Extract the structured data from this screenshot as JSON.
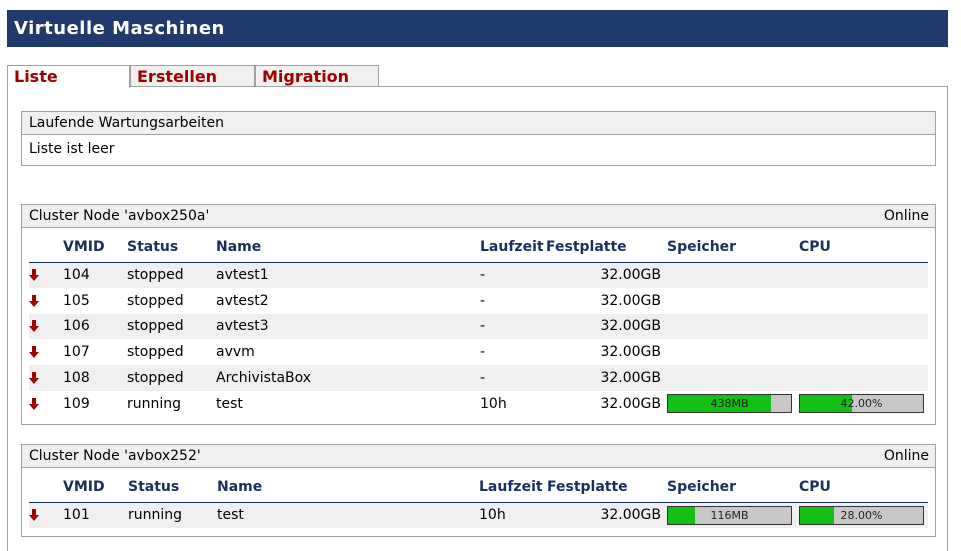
{
  "title": "Virtuelle Maschinen",
  "tabs": [
    {
      "label": "Liste",
      "active": true
    },
    {
      "label": "Erstellen",
      "active": false
    },
    {
      "label": "Migration",
      "active": false
    }
  ],
  "maintenance": {
    "header": "Laufende Wartungsarbeiten",
    "message": "Liste ist leer"
  },
  "columns": {
    "vmid": "VMID",
    "status": "Status",
    "name": "Name",
    "uptime": "Laufzeit",
    "disk": "Festplatte",
    "memory": "Speicher",
    "cpu": "CPU"
  },
  "nodes": [
    {
      "header": "Cluster Node 'avbox250a'",
      "state": "Online",
      "vms": [
        {
          "vmid": "104",
          "status": "stopped",
          "name": "avtest1",
          "uptime": "-",
          "disk": "32.00GB"
        },
        {
          "vmid": "105",
          "status": "stopped",
          "name": "avtest2",
          "uptime": "-",
          "disk": "32.00GB"
        },
        {
          "vmid": "106",
          "status": "stopped",
          "name": "avtest3",
          "uptime": "-",
          "disk": "32.00GB"
        },
        {
          "vmid": "107",
          "status": "stopped",
          "name": "avvm",
          "uptime": "-",
          "disk": "32.00GB"
        },
        {
          "vmid": "108",
          "status": "stopped",
          "name": "ArchivistaBox",
          "uptime": "-",
          "disk": "32.00GB"
        },
        {
          "vmid": "109",
          "status": "running",
          "name": "test",
          "uptime": "10h",
          "disk": "32.00GB",
          "memory": {
            "label": "438MB",
            "fraction": 0.84
          },
          "cpu": {
            "label": "42.00%",
            "fraction": 0.42
          }
        }
      ]
    },
    {
      "header": "Cluster Node 'avbox252'",
      "state": "Online",
      "vms": [
        {
          "vmid": "101",
          "status": "running",
          "name": "test",
          "uptime": "10h",
          "disk": "32.00GB",
          "memory": {
            "label": "116MB",
            "fraction": 0.22
          },
          "cpu": {
            "label": "28.00%",
            "fraction": 0.28
          }
        }
      ]
    }
  ],
  "colors": {
    "header_bg": "#203a6b",
    "tab_text": "#a00000",
    "bar_fill": "#11c011",
    "arrow": "#a00000"
  }
}
